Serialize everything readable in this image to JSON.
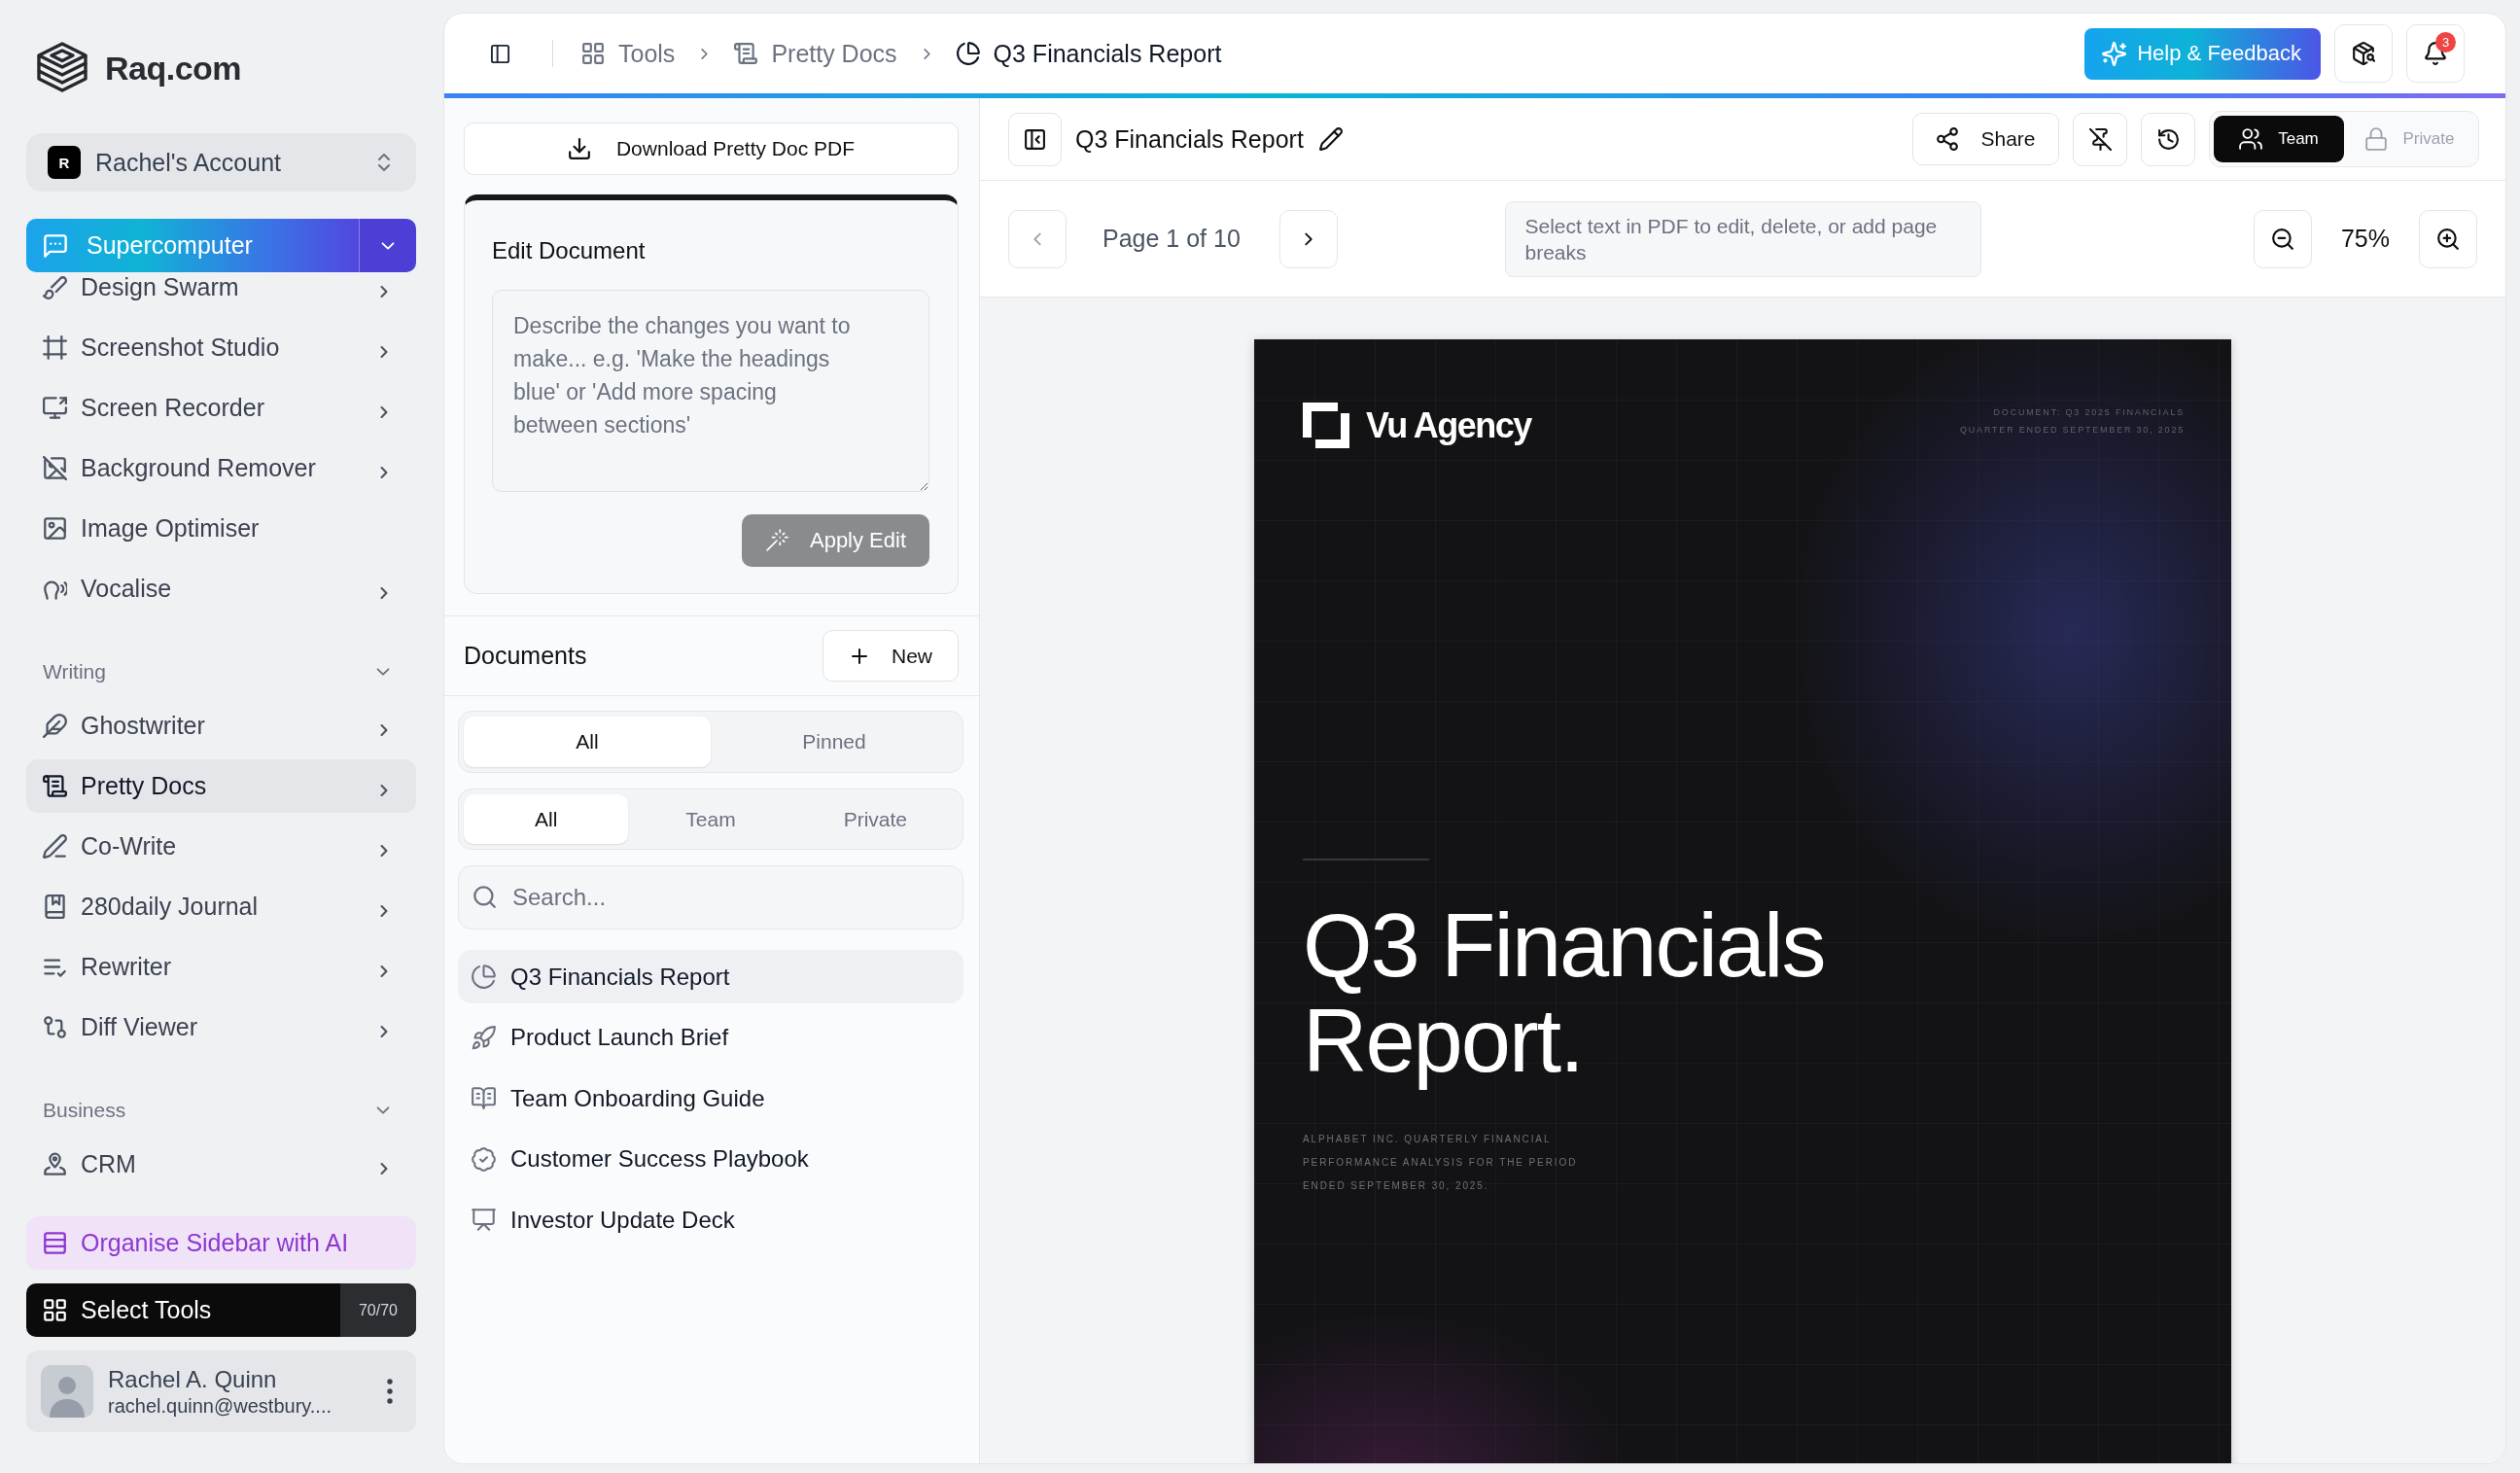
{
  "sidebar": {
    "brand": "Raq.com",
    "account": {
      "initial": "R",
      "name": "Rachel's Account"
    },
    "featured_tool": {
      "label": "Supercomputer"
    },
    "groups": [
      {
        "items": [
          {
            "label": "Design Swarm",
            "submenu": true,
            "selected": false
          },
          {
            "label": "Screenshot Studio",
            "submenu": true,
            "selected": false
          },
          {
            "label": "Screen Recorder",
            "submenu": true,
            "selected": false
          },
          {
            "label": "Background Remover",
            "submenu": true,
            "selected": false
          },
          {
            "label": "Image Optimiser",
            "submenu": false,
            "selected": false
          },
          {
            "label": "Vocalise",
            "submenu": true,
            "selected": false
          }
        ]
      },
      {
        "title": "Writing",
        "expanded": true,
        "items": [
          {
            "label": "Ghostwriter",
            "submenu": true,
            "selected": false
          },
          {
            "label": "Pretty Docs",
            "submenu": true,
            "selected": true
          },
          {
            "label": "Co-Write",
            "submenu": true,
            "selected": false
          },
          {
            "label": "280daily Journal",
            "submenu": true,
            "selected": false
          },
          {
            "label": "Rewriter",
            "submenu": true,
            "selected": false
          },
          {
            "label": "Diff Viewer",
            "submenu": true,
            "selected": false
          }
        ]
      },
      {
        "title": "Business",
        "expanded": true,
        "items": [
          {
            "label": "CRM",
            "submenu": true,
            "selected": false
          }
        ]
      }
    ],
    "organise_button": "Organise Sidebar with AI",
    "select_tools": {
      "label": "Select Tools",
      "count": "70/70"
    },
    "user": {
      "name": "Rachel A. Quinn",
      "email": "rachel.quinn@westbury...."
    }
  },
  "top_bar": {
    "breadcrumbs": [
      {
        "label": "Tools",
        "current": false
      },
      {
        "label": "Pretty Docs",
        "current": false
      },
      {
        "label": "Q3 Financials Report",
        "current": true
      }
    ],
    "help_button": "Help & Feedback",
    "notification_count": "3"
  },
  "editor": {
    "download_button": "Download Pretty Doc PDF",
    "edit_card": {
      "title": "Edit Document",
      "prompt": {
        "placeholder": "Describe the changes you want to make... e.g. 'Make the headings blue' or 'Add more spacing between sections'"
      },
      "apply_button": {
        "label": "Apply Edit",
        "disabled": true
      }
    },
    "documents": {
      "title": "Documents",
      "new_button": "New",
      "filter_tabs": [
        {
          "label": "All",
          "selected": true
        },
        {
          "label": "Pinned",
          "selected": false
        }
      ],
      "scope_tabs": [
        {
          "label": "All",
          "selected": true
        },
        {
          "label": "Team",
          "selected": false
        },
        {
          "label": "Private",
          "selected": false
        }
      ],
      "search": {
        "placeholder": "Search..."
      },
      "items": [
        {
          "title": "Q3 Financials Report",
          "selected": true
        },
        {
          "title": "Product Launch Brief",
          "selected": false
        },
        {
          "title": "Team Onboarding Guide",
          "selected": false
        },
        {
          "title": "Customer Success Playbook",
          "selected": false
        },
        {
          "title": "Investor Update Deck",
          "selected": false
        }
      ]
    }
  },
  "viewer": {
    "title": "Q3 Financials Report",
    "share_button": "Share",
    "visibility": [
      {
        "label": "Team",
        "selected": true
      },
      {
        "label": "Private",
        "selected": false
      }
    ],
    "page_indicator": "Page 1 of 10",
    "hint": "Select text in PDF to edit, delete, or add page breaks",
    "zoom": "75%",
    "page": {
      "brand": "Vu Agency",
      "meta": [
        "DOCUMENT: Q3 2025 FINANCIALS",
        "QUARTER ENDED SEPTEMBER 30, 2025"
      ],
      "title": "Q3 Financials Report.",
      "subtitle": "ALPHABET INC. QUARTERLY FINANCIAL PERFORMANCE ANALYSIS FOR THE PERIOD ENDED SEPTEMBER 30, 2025."
    }
  }
}
